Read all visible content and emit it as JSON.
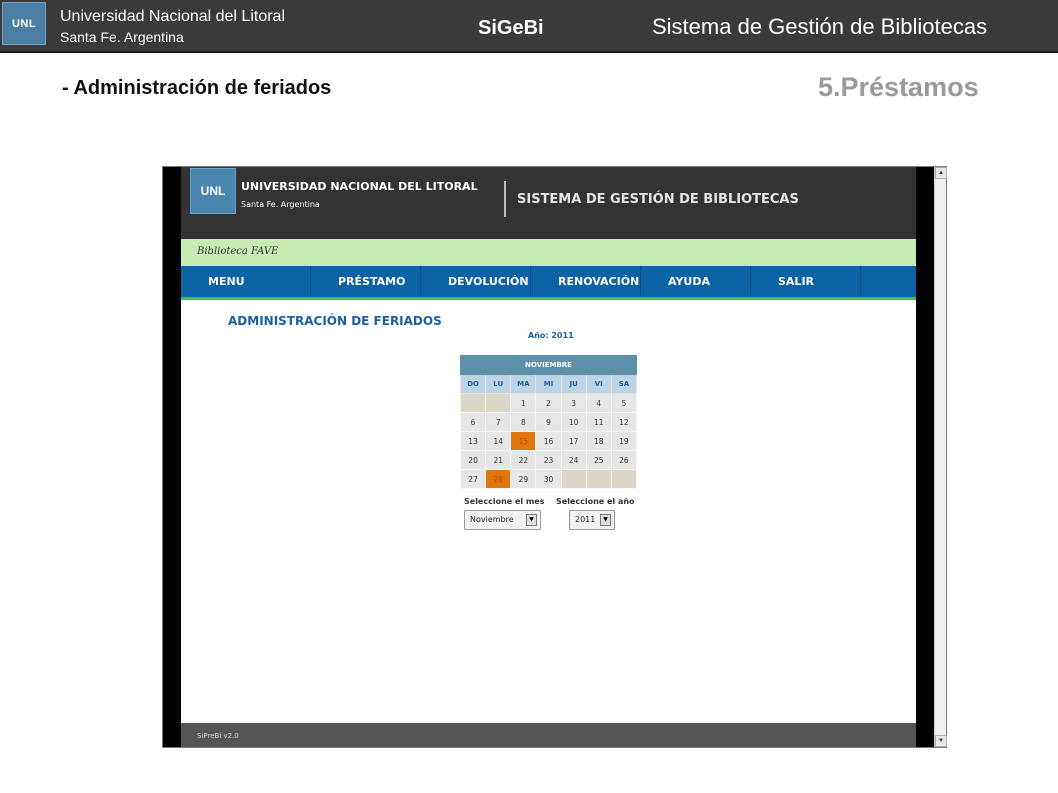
{
  "slide": {
    "logo": "UNL",
    "university": "Universidad Nacional del Litoral",
    "city": "Santa Fe. Argentina",
    "app_short": "SiGeBi",
    "system": "Sistema de Gestión de Bibliotecas",
    "subtitle": "- Administración de feriados",
    "section": "5.Préstamos"
  },
  "app": {
    "logo": "UNL",
    "university": "UNIVERSIDAD NACIONAL DEL LITORAL",
    "city": "Santa Fe. Argentina",
    "system": "SISTEMA DE GESTIÓN DE BIBLIOTECAS",
    "library": "Biblioteca FAVE",
    "nav": [
      "MENU",
      "PRÉSTAMO",
      "DEVOLUCIÓN",
      "RENOVACIÓN",
      "AYUDA",
      "SALIR"
    ],
    "title": "ADMINISTRACIÓN DE FERIADOS",
    "year_label": "Año: 2011",
    "calendar": {
      "month": "NOVIEMBRE",
      "days_of_week": [
        "DO",
        "LU",
        "MA",
        "MI",
        "JU",
        "VI",
        "SA"
      ],
      "weeks": [
        [
          "",
          "",
          "1",
          "2",
          "3",
          "4",
          "5"
        ],
        [
          "6",
          "7",
          "8",
          "9",
          "10",
          "11",
          "12"
        ],
        [
          "13",
          "14",
          "15",
          "16",
          "17",
          "18",
          "19"
        ],
        [
          "20",
          "21",
          "22",
          "23",
          "24",
          "25",
          "26"
        ],
        [
          "27",
          "28",
          "29",
          "30",
          "",
          "",
          ""
        ]
      ],
      "holidays": [
        "15",
        "28"
      ]
    },
    "select_month_label": "Seleccione el mes",
    "select_year_label": "Seleccione el año",
    "selected_month": "Noviembre",
    "selected_year": "2011",
    "footer": "SiPreBi v2.0"
  },
  "icons": {
    "dropdown": "▼",
    "scroll_up": "▲",
    "scroll_down": "▼"
  },
  "colors": {
    "nav_bg": "#0b62a4",
    "library_bar": "#c6ecb4",
    "holiday": "#e0750c",
    "calendar_header": "#5f90aa"
  }
}
